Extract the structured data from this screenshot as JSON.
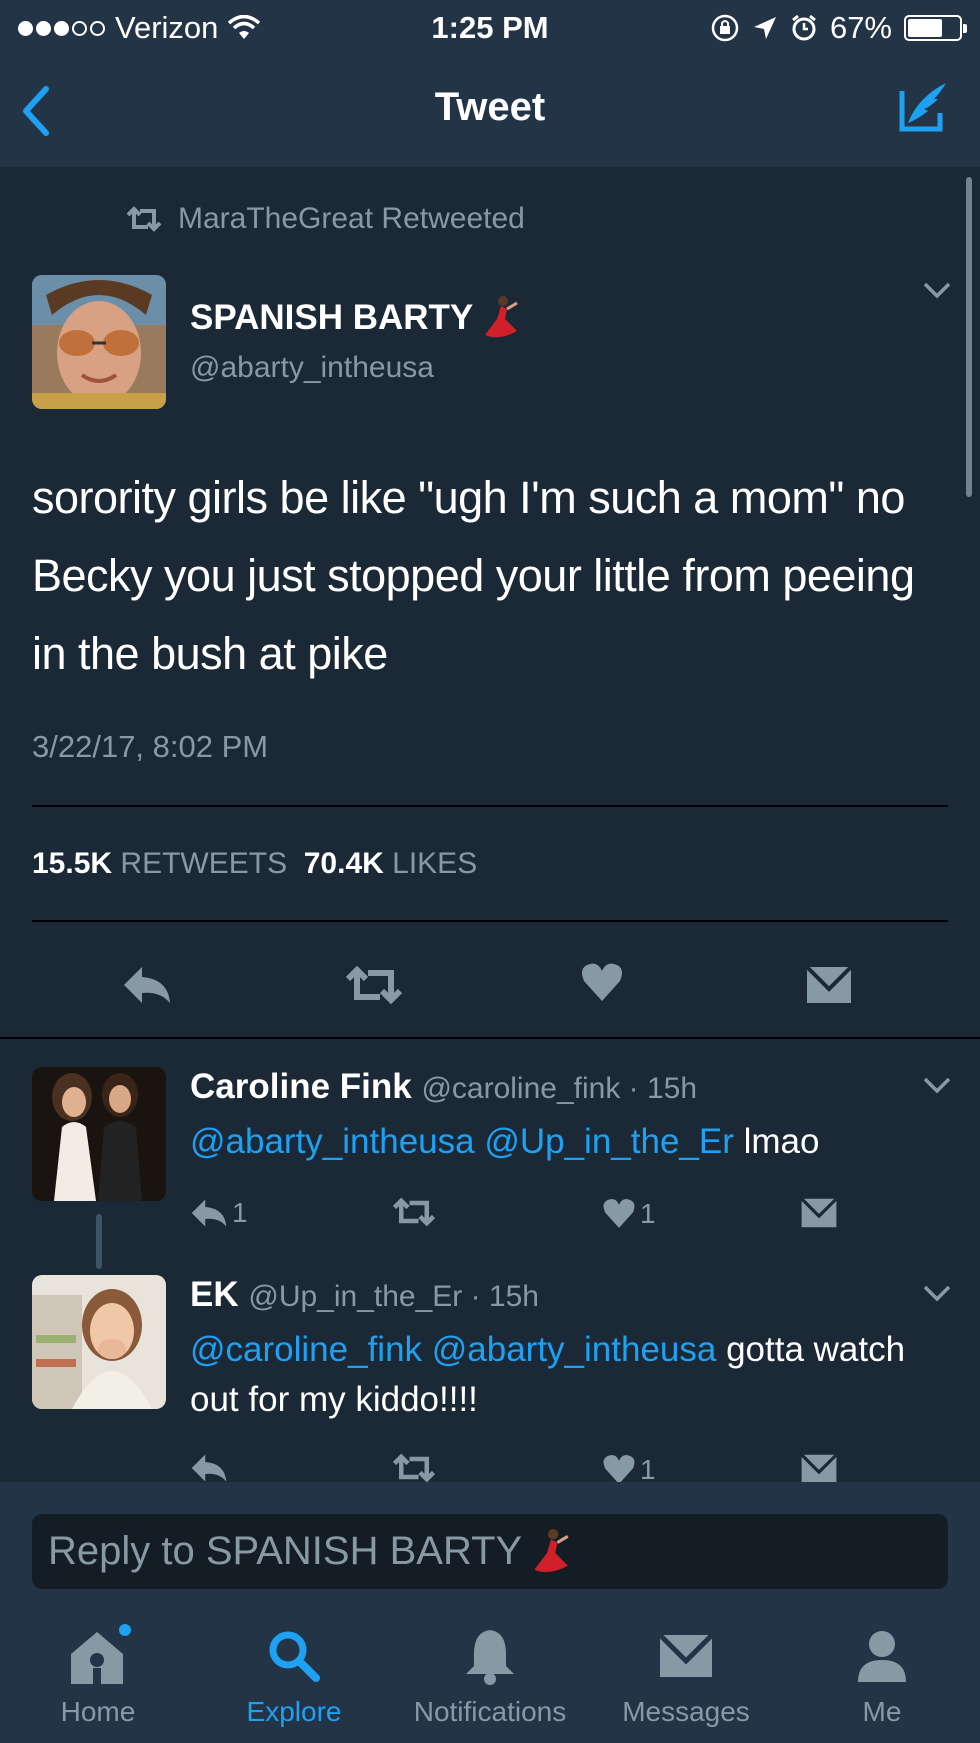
{
  "status_bar": {
    "carrier": "Verizon",
    "time": "1:25 PM",
    "battery": "67%",
    "battery_level": 0.67
  },
  "nav": {
    "title": "Tweet"
  },
  "tweet": {
    "retweeted_by": "MaraTheGreat Retweeted",
    "author_name": "SPANISH BARTY",
    "author_handle": "@abarty_intheusa",
    "text": "sorority girls be like \"ugh I'm such a mom\" no Becky you just stopped your little from peeing in the bush at pike",
    "timestamp": "3/22/17, 8:02 PM",
    "retweets_count": "15.5K",
    "retweets_label": "RETWEETS",
    "likes_count": "70.4K",
    "likes_label": "LIKES"
  },
  "replies": [
    {
      "name": "Caroline Fink",
      "meta": "@caroline_fink · 15h",
      "mentions": "@abarty_intheusa @Up_in_the_Er",
      "text": " lmao",
      "reply_count": "1",
      "like_count": "1"
    },
    {
      "name": "EK",
      "meta": "@Up_in_the_Er · 15h",
      "mentions": "@caroline_fink @abarty_intheusa",
      "text": " gotta watch out for my kiddo!!!!",
      "reply_count": "",
      "like_count": "1"
    }
  ],
  "reply_box": {
    "placeholder": "Reply to SPANISH BARTY"
  },
  "tabs": [
    {
      "label": "Home",
      "icon": "home-icon"
    },
    {
      "label": "Explore",
      "icon": "search-icon",
      "active": true
    },
    {
      "label": "Notifications",
      "icon": "bell-icon"
    },
    {
      "label": "Messages",
      "icon": "envelope-icon"
    },
    {
      "label": "Me",
      "icon": "person-icon"
    }
  ],
  "colors": {
    "accent": "#1da1f2",
    "background": "#1b2836",
    "bar": "#243447",
    "muted": "#8899a6"
  }
}
